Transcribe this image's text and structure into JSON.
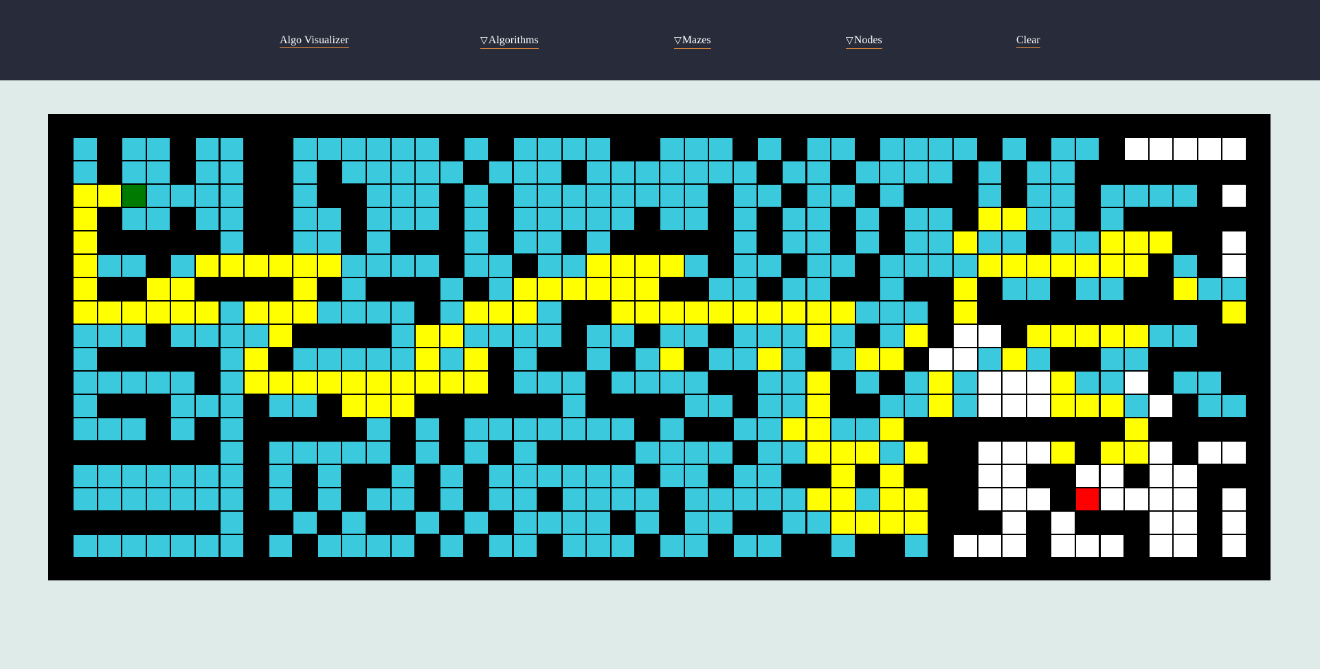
{
  "navbar": {
    "title": "Algo Visualizer",
    "algorithms": "Algorithms",
    "mazes": "Mazes",
    "nodes": "Nodes",
    "clear": "Clear",
    "dropdown_glyph": "▽"
  },
  "colors": {
    "navbar_bg": "#282c3a",
    "page_bg": "#dfebe9",
    "wall": "#000000",
    "visited": "#3bc9dd",
    "path": "#ffff00",
    "unvisited": "#ffffff",
    "start": "#007a00",
    "end": "#ff0000",
    "link_underline": "#e08a3c"
  },
  "grid": {
    "cols": 48,
    "rows": 18,
    "legend": {
      "#": "wall",
      "v": "visited",
      "y": "path",
      "w": "unvisited",
      "S": "start",
      "E": "end"
    },
    "cells": [
      "v#vv#vv##vvvvvv#v#vvvv##vvv#v#vv#vvvv#v#vv#wwwwwww",
      "v#vv#vv##v#vvvvv#vvv#vvvvvvv#vv#vvvv#v#vv#########",
      "yySvvvv##v##vvv#v#vvvvvvvv#vv#vv#v###v#vv#vvvv#ww",
      "y#vv#vv##vv#vvv#v#vvvvv#vv#v#vv#v#vv#yyvv#v#####w",
      "y#####v##vv#v###v#vv#v#####v#vv#v#vvyvv#vvyyy##ww",
      "yvv#vyyyyyyvvvv#vv#vvyyyyv#vv#vv#vvvvyyyyyyy#v#w",
      "y##yy####y#v###v#vyyyyyy##vv#vv##v##y#vv#vv##yvv",
      "yyyyyyvyyyvvvv#vyyyv##yyyyyyyyyyvvv#y##########y##",
      "vvv#vvvvy####vyyvvvv#vv#vv#vvvyv#vy#ww#yyyyyvv",
      "v#####vy#vvvvvyvy#v##v#vy#vvyv#vyy#wwvyv##vv",
      "vvvvv#vyyyyyyyyyy#vvv#vvvv##vvy#v#vyvwwwyvvw#vv",
      "v###vvv#vv#yyy######v####vv#vvy##vvyvwwwyyyvw#vv",
      "vvv#v#v#####v#v#vvvvvvv#v##vvyyvvy#########y#####",
      "######v#vvvvv#v#v#v####vvvv#vvyyyvy##wwwy#yyw#ww",
      "vvvvvvv#v#v##v#v#vvvvvv#vv#vv##y#y###ww##ww#ww",
      "vvvvvvv#v#v#vv#v#vv#vvvv#vvvvvyyvyy##www#Ewwww#ww",
      "######v##v#v##v#v#vvvv#v#vv##vvyyyy###w#w###ww#ww",
      "vvvvvvv#v#vvvv#v#vv#vvv#vv#vv##v##v#www#www#ww#ww"
    ]
  }
}
